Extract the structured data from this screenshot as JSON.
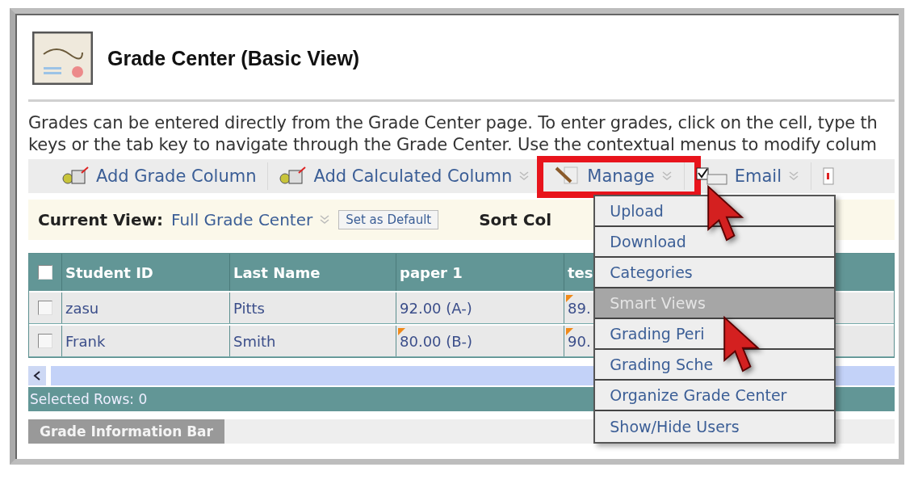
{
  "header": {
    "title": "Grade Center (Basic View)"
  },
  "description": [
    "Grades can be entered directly from the Grade Center page. To enter grades, click on the cell, type th",
    "keys or the tab key to navigate through the Grade Center. Use the contextual menus to modify colum"
  ],
  "toolbar": [
    {
      "kind": "add",
      "label": "Add Grade Column",
      "menu": false,
      "highlighted": false
    },
    {
      "kind": "add",
      "label": "Add Calculated Column",
      "menu": true,
      "highlighted": false
    },
    {
      "kind": "manage",
      "label": "Manage",
      "menu": true,
      "highlighted": true
    },
    {
      "kind": "email",
      "label": "Email",
      "menu": true,
      "highlighted": false
    }
  ],
  "view_bar": {
    "label": "Current View:",
    "view": "Full Grade Center",
    "default_button": "Set as Default",
    "sort_label": "Sort Col"
  },
  "table": {
    "select_all_checked": false,
    "columns": [
      "Student ID",
      "Last Name",
      "paper 1",
      "tes"
    ],
    "rows": [
      {
        "checked": false,
        "cells": [
          {
            "text": "zasu",
            "flag": false
          },
          {
            "text": "Pitts",
            "flag": false
          },
          {
            "text": "92.00 (A-)",
            "flag": false
          },
          {
            "text": "89.",
            "flag": true
          }
        ]
      },
      {
        "checked": false,
        "cells": [
          {
            "text": "Frank",
            "flag": false
          },
          {
            "text": "Smith",
            "flag": false
          },
          {
            "text": "80.00 (B-)",
            "flag": true
          },
          {
            "text": "90.",
            "flag": true
          }
        ]
      }
    ]
  },
  "status_bar": "Selected Rows: 0",
  "info_tab": "Grade Information Bar",
  "manage_menu": [
    {
      "label": "Upload",
      "selected": false
    },
    {
      "label": "Download",
      "selected": false
    },
    {
      "label": "Categories",
      "selected": false
    },
    {
      "label": "Smart Views",
      "selected": true
    },
    {
      "label": "Grading Peri",
      "selected": false
    },
    {
      "label": "Grading Sche",
      "selected": false
    },
    {
      "label": "Organize Grade Center",
      "selected": false
    },
    {
      "label": "Show/Hide Users",
      "selected": false
    }
  ]
}
